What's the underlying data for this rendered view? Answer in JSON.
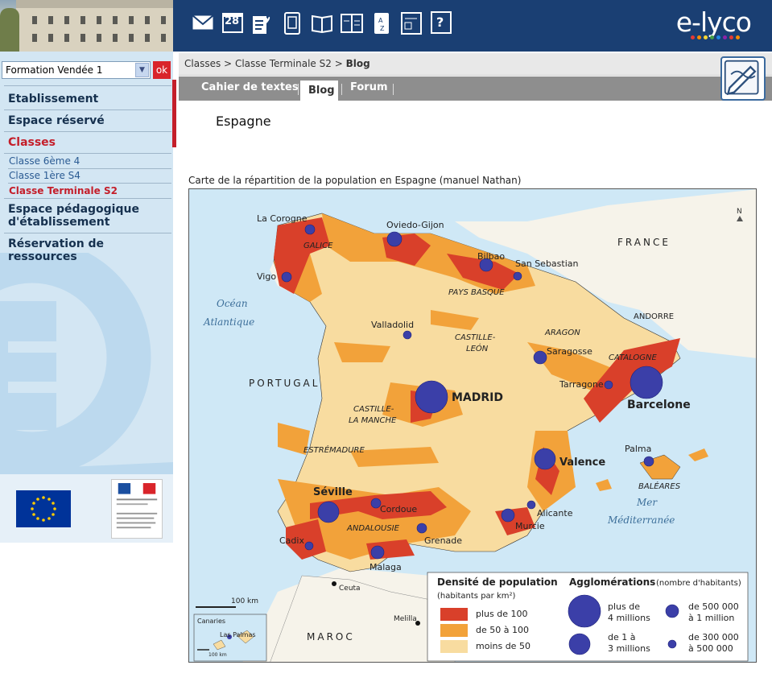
{
  "header": {
    "brand": "e-lyco",
    "brand_dot_colors": [
      "#e53935",
      "#fb8c00",
      "#fdd835",
      "#43a047",
      "#1e88e5",
      "#8e24aa",
      "#e53935",
      "#fb8c00"
    ],
    "toolbar_icons": [
      "mail-icon",
      "calendar-icon",
      "favorites-icon",
      "tablet-icon",
      "open-book-icon",
      "planner-icon",
      "contacts-icon",
      "preferences-icon",
      "help-icon"
    ],
    "calendar_day": "28",
    "help_glyph": "?"
  },
  "sidebar": {
    "formation_select": "Formation Vendée 1",
    "ok_label": "ok",
    "etablissement": "Etablissement",
    "espace_reserve": "Espace réservé",
    "classes": "Classes",
    "class_items": [
      "Classe 6ème 4",
      "Classe 1ère S4",
      "Classe Terminale S2"
    ],
    "espace_peda_line1": "Espace pédagogique",
    "espace_peda_line2": "d'établissement",
    "reservation_line1": "Réservation de",
    "reservation_line2": "ressources"
  },
  "breadcrumb": {
    "part1": "Classes",
    "sep": ">",
    "part2": "Classe Terminale S2",
    "current": "Blog"
  },
  "tabs": [
    "Cahier de textes",
    "Blog",
    "Forum"
  ],
  "active_tab": "Blog",
  "page_title": "Espagne",
  "caption": "Carte de la répartition de la population en Espagne (manuel Nathan)",
  "map": {
    "north_symbol": "N",
    "cities": {
      "la_corogne": "La Corogne",
      "oviedo": "Oviedo-Gijon",
      "bilbao": "Bilbao",
      "san_sebastian": "San Sebastian",
      "vigo": "Vigo",
      "valladolid": "Valladolid",
      "saragosse": "Saragosse",
      "tarragone": "Tarragone",
      "barcelone": "Barcelone",
      "madrid": "MADRID",
      "valence": "Valence",
      "palma": "Palma",
      "seville": "Séville",
      "cordoue": "Cordoue",
      "alicante": "Alicante",
      "murcie": "Murcie",
      "cadix": "Cadix",
      "grenade": "Grenade",
      "malaga": "Malaga",
      "ceuta": "Ceuta",
      "melilla": "Melilla",
      "las_palmas": "Las Palmas"
    },
    "regions": {
      "galice": "GALICE",
      "pays_basque": "PAYS BASQUE",
      "castille_leon_1": "CASTILLE-",
      "castille_leon_2": "LEÓN",
      "aragon": "ARAGON",
      "catalogne": "CATALOGNE",
      "castille_manche_1": "CASTILLE-",
      "castille_manche_2": "LA MANCHE",
      "estremadure": "ESTRÉMADURE",
      "andalousie": "ANDALOUSIE",
      "baleares": "BALÉARES"
    },
    "countries": {
      "france": "FRANCE",
      "andorre": "ANDORRE",
      "portugal": "PORTUGAL",
      "maroc": "MAROC"
    },
    "seas": {
      "ocean_1": "Océan",
      "ocean_2": "Atlantique",
      "mer_1": "Mer",
      "mer_2": "Méditerranée"
    },
    "scale_label": "100 km",
    "inset_title": "Canaries",
    "inset_scale": "100 km",
    "legend": {
      "density_title": "Densité de population",
      "density_sub": "(habitants par km²)",
      "density_items": [
        {
          "label": "plus de 100",
          "color": "#d9402a"
        },
        {
          "label": "de 50 à 100",
          "color": "#f2a23a"
        },
        {
          "label": "moins de 50",
          "color": "#f8dca0"
        }
      ],
      "agglo_title": "Agglomérations",
      "agglo_sub": "(nombre d'habitants)",
      "agglo_items": [
        {
          "line1": "plus de",
          "line2": "4 millions"
        },
        {
          "line1": "de 1 à",
          "line2": "3 millions"
        },
        {
          "line1": "de 500 000",
          "line2": "à 1 million"
        },
        {
          "line1": "de 300 000",
          "line2": "à 500 000"
        }
      ]
    }
  }
}
